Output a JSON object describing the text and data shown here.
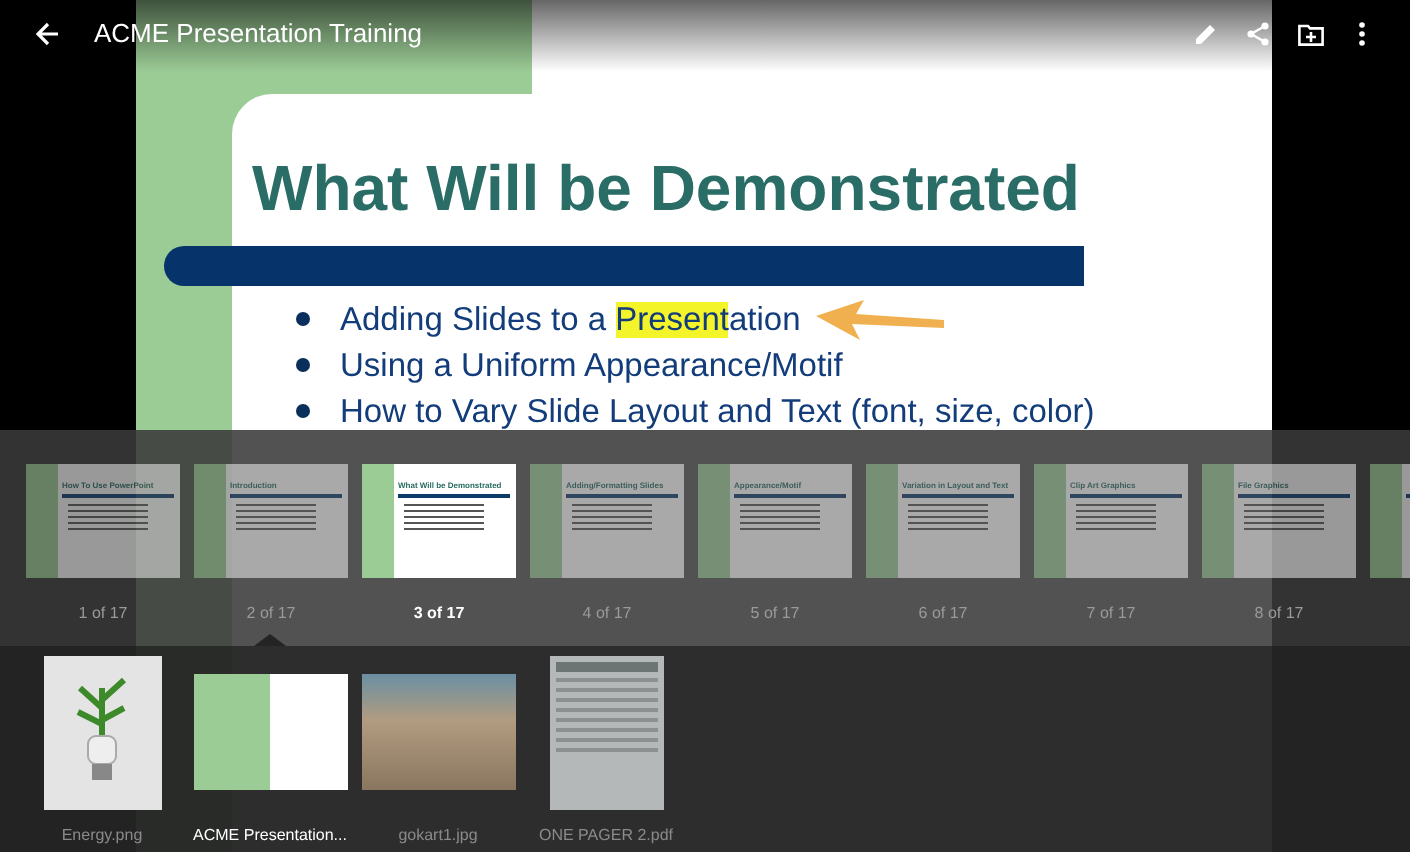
{
  "app_bar": {
    "title": "ACME Presentation Training"
  },
  "slide": {
    "title": "What Will be Demonstrated",
    "bullets": [
      {
        "text": "Adding Slides to a **Present**ation"
      },
      {
        "text": "Using a Uniform Appearance/Motif"
      },
      {
        "text": "How to Vary Slide Layout and Text (font, size, color)"
      }
    ]
  },
  "slide_strip": [
    {
      "title": "How To Use PowerPoint",
      "label": "1 of 17",
      "selected": false
    },
    {
      "title": "Introduction",
      "label": "2 of 17",
      "selected": false
    },
    {
      "title": "What Will be Demonstrated",
      "label": "3 of 17",
      "selected": true
    },
    {
      "title": "Adding/Formatting Slides",
      "label": "4 of 17",
      "selected": false
    },
    {
      "title": "Appearance/Motif",
      "label": "5 of 17",
      "selected": false
    },
    {
      "title": "Variation in Layout and Text",
      "label": "6 of 17",
      "selected": false
    },
    {
      "title": "Clip Art Graphics",
      "label": "7 of 17",
      "selected": false
    },
    {
      "title": "File Graphics",
      "label": "8 of 17",
      "selected": false
    },
    {
      "selected": false
    }
  ],
  "files": [
    {
      "kind": "image",
      "name": "Energy.png",
      "selected": false
    },
    {
      "kind": "slides",
      "name": "ACME Presentation...",
      "selected": true
    },
    {
      "kind": "photo",
      "name": "gokart1.jpg",
      "selected": false
    },
    {
      "kind": "pdf",
      "name": "ONE PAGER 2.pdf",
      "selected": false
    }
  ]
}
